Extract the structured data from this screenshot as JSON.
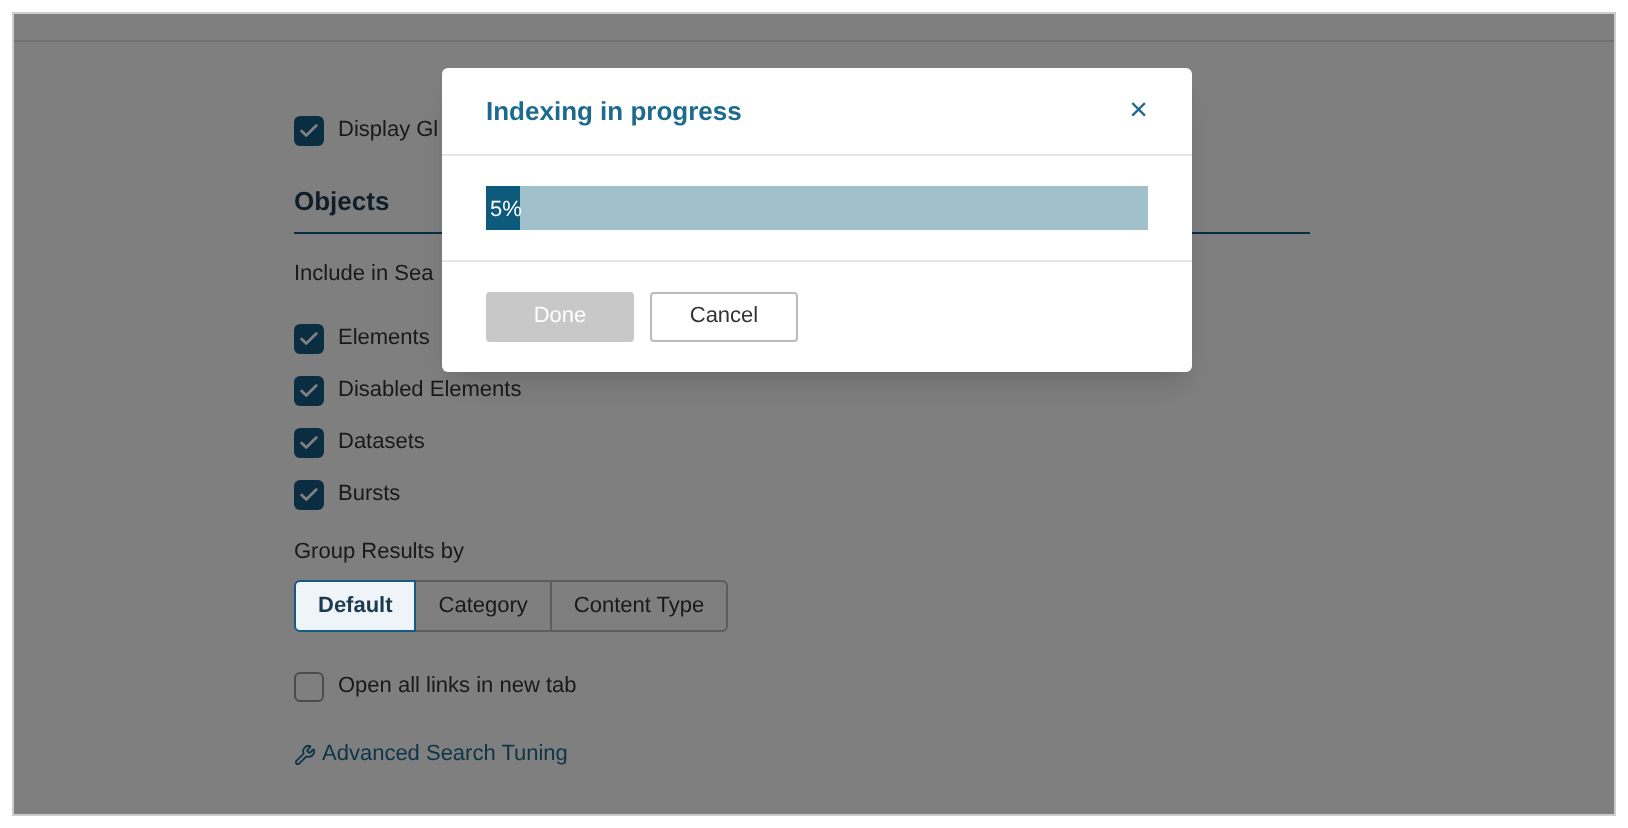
{
  "settings": {
    "display_option": {
      "label": "Display Gl",
      "checked": true
    },
    "section_title": "Objects",
    "include_label": "Include in Sea",
    "include_items": [
      {
        "label": "Elements",
        "checked": true
      },
      {
        "label": "Disabled Elements",
        "checked": true
      },
      {
        "label": "Datasets",
        "checked": true
      },
      {
        "label": "Bursts",
        "checked": true
      }
    ],
    "group_label": "Group Results by",
    "group_options": [
      {
        "label": "Default",
        "selected": true
      },
      {
        "label": "Category",
        "selected": false
      },
      {
        "label": "Content Type",
        "selected": false
      }
    ],
    "new_tab": {
      "label": "Open all links in new tab",
      "checked": false
    },
    "advanced_link": "Advanced Search Tuning"
  },
  "dialog": {
    "title": "Indexing in progress",
    "close": "×",
    "progress": {
      "level": 0.05,
      "reading": "5%"
    },
    "buttons": [
      {
        "label": "Done",
        "disabled": true
      },
      {
        "label": "Cancel",
        "disabled": false
      }
    ]
  }
}
